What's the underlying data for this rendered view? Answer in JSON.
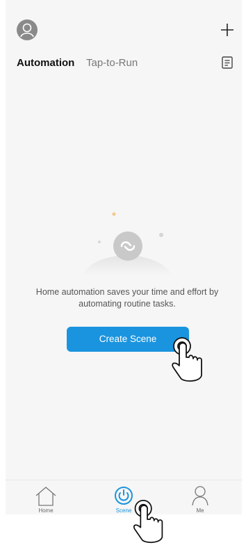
{
  "header": {
    "tabs": [
      {
        "label": "Automation",
        "active": true
      },
      {
        "label": "Tap-to-Run",
        "active": false
      }
    ]
  },
  "empty_state": {
    "description": "Home automation saves your time and effort by automating routine tasks.",
    "cta_label": "Create Scene"
  },
  "nav": {
    "items": [
      {
        "label": "Home",
        "icon": "house-icon",
        "active": false
      },
      {
        "label": "Scene",
        "icon": "power-icon",
        "active": true
      },
      {
        "label": "Me",
        "icon": "user-icon",
        "active": false
      }
    ]
  },
  "colors": {
    "accent": "#1a94de",
    "background": "#f6f6f6"
  }
}
